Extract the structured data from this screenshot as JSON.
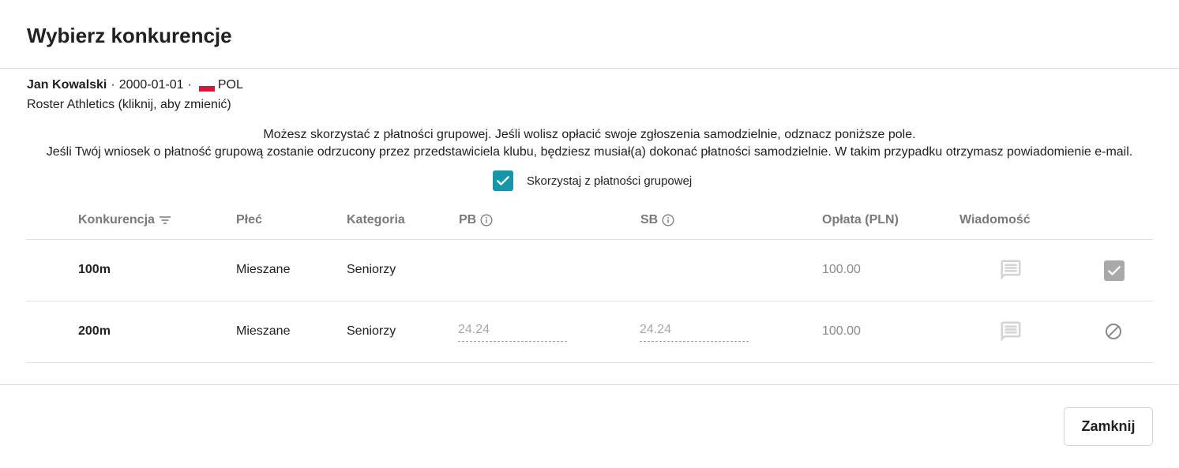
{
  "dialog": {
    "title": "Wybierz konkurencje"
  },
  "athlete": {
    "name": "Jan Kowalski",
    "dot": "·",
    "birthdate": "2000-01-01",
    "country": "POL",
    "club": "Roster Athletics (kliknij, aby zmienić)"
  },
  "group_payment": {
    "info_line1": "Możesz skorzystać z płatności grupowej. Jeśli wolisz opłacić swoje zgłoszenia samodzielnie, odznacz poniższe pole.",
    "info_line2": "Jeśli Twój wniosek o płatność grupową zostanie odrzucony przez przedstawiciela klubu, będziesz musiał(a) dokonać płatności samodzielnie. W takim przypadku otrzymasz powiadomienie e-mail.",
    "checkbox_label": "Skorzystaj z płatności grupowej",
    "checked": true
  },
  "table": {
    "headers": {
      "event": "Konkurencja",
      "gender": "Płeć",
      "category": "Kategoria",
      "pb": "PB",
      "sb": "SB",
      "fee": "Opłata (PLN)",
      "message": "Wiadomość"
    },
    "rows": [
      {
        "event": "100m",
        "gender": "Mieszane",
        "category": "Seniorzy",
        "pb": "",
        "sb": "",
        "fee": "100.00",
        "status": "selected"
      },
      {
        "event": "200m",
        "gender": "Mieszane",
        "category": "Seniorzy",
        "pb": "24.24",
        "sb": "24.24",
        "fee": "100.00",
        "status": "unavailable"
      }
    ]
  },
  "footer": {
    "close_label": "Zamknij"
  },
  "colors": {
    "accent": "#1597a9",
    "muted": "#7a7a7a",
    "disabled": "#a9a9a9"
  }
}
